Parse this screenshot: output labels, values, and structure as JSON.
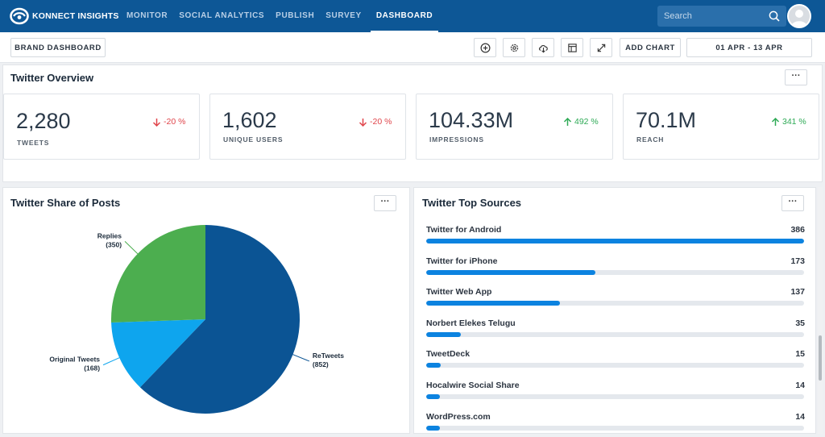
{
  "app": {
    "logo_text": "KONNECT INSIGHTS",
    "nav": [
      {
        "label": "MONITOR",
        "active": false
      },
      {
        "label": "SOCIAL ANALYTICS",
        "active": false
      },
      {
        "label": "PUBLISH",
        "active": false
      },
      {
        "label": "SURVEY",
        "active": false
      },
      {
        "label": "DASHBOARD",
        "active": true
      }
    ],
    "search_placeholder": "Search"
  },
  "toolbar": {
    "brand_dashboard": "BRAND DASHBOARD",
    "add_chart": "ADD CHART",
    "date_range": "01 APR - 13 APR",
    "icons": [
      "add-circle-icon",
      "settings-icon",
      "cloud-download-icon",
      "layout-icon",
      "expand-icon"
    ]
  },
  "overview": {
    "title": "Twitter Overview",
    "more": "···",
    "kpis": [
      {
        "value": "2,280",
        "label": "TWEETS",
        "change": "-20 %",
        "direction": "down"
      },
      {
        "value": "1,602",
        "label": "UNIQUE USERS",
        "change": "-20 %",
        "direction": "down"
      },
      {
        "value": "104.33M",
        "label": "IMPRESSIONS",
        "change": "492 %",
        "direction": "up"
      },
      {
        "value": "70.1M",
        "label": "REACH",
        "change": "341 %",
        "direction": "up"
      }
    ]
  },
  "share": {
    "title": "Twitter Share of Posts",
    "more": "···"
  },
  "sources": {
    "title": "Twitter Top Sources",
    "more": "···"
  },
  "chart_data": [
    {
      "type": "pie",
      "title": "Twitter Share of Posts",
      "categories": [
        "ReTweets",
        "Original Tweets",
        "Replies"
      ],
      "values": [
        852,
        168,
        350
      ],
      "labels": [
        [
          "ReTweets",
          "(852)"
        ],
        [
          "Original Tweets",
          "(168)"
        ],
        [
          "Replies",
          "(350)"
        ]
      ],
      "colors": [
        "#0b5494",
        "#0ea5ee",
        "#4cae4f"
      ]
    },
    {
      "type": "bar",
      "title": "Twitter Top Sources",
      "orientation": "horizontal",
      "categories": [
        "Twitter for Android",
        "Twitter for iPhone",
        "Twitter Web App",
        "Norbert Elekes Telugu",
        "TweetDeck",
        "Hocalwire Social Share",
        "WordPress.com"
      ],
      "values": [
        386,
        173,
        137,
        35,
        15,
        14,
        14
      ],
      "xlim": [
        0,
        386
      ],
      "color": "#0c83e0"
    }
  ]
}
